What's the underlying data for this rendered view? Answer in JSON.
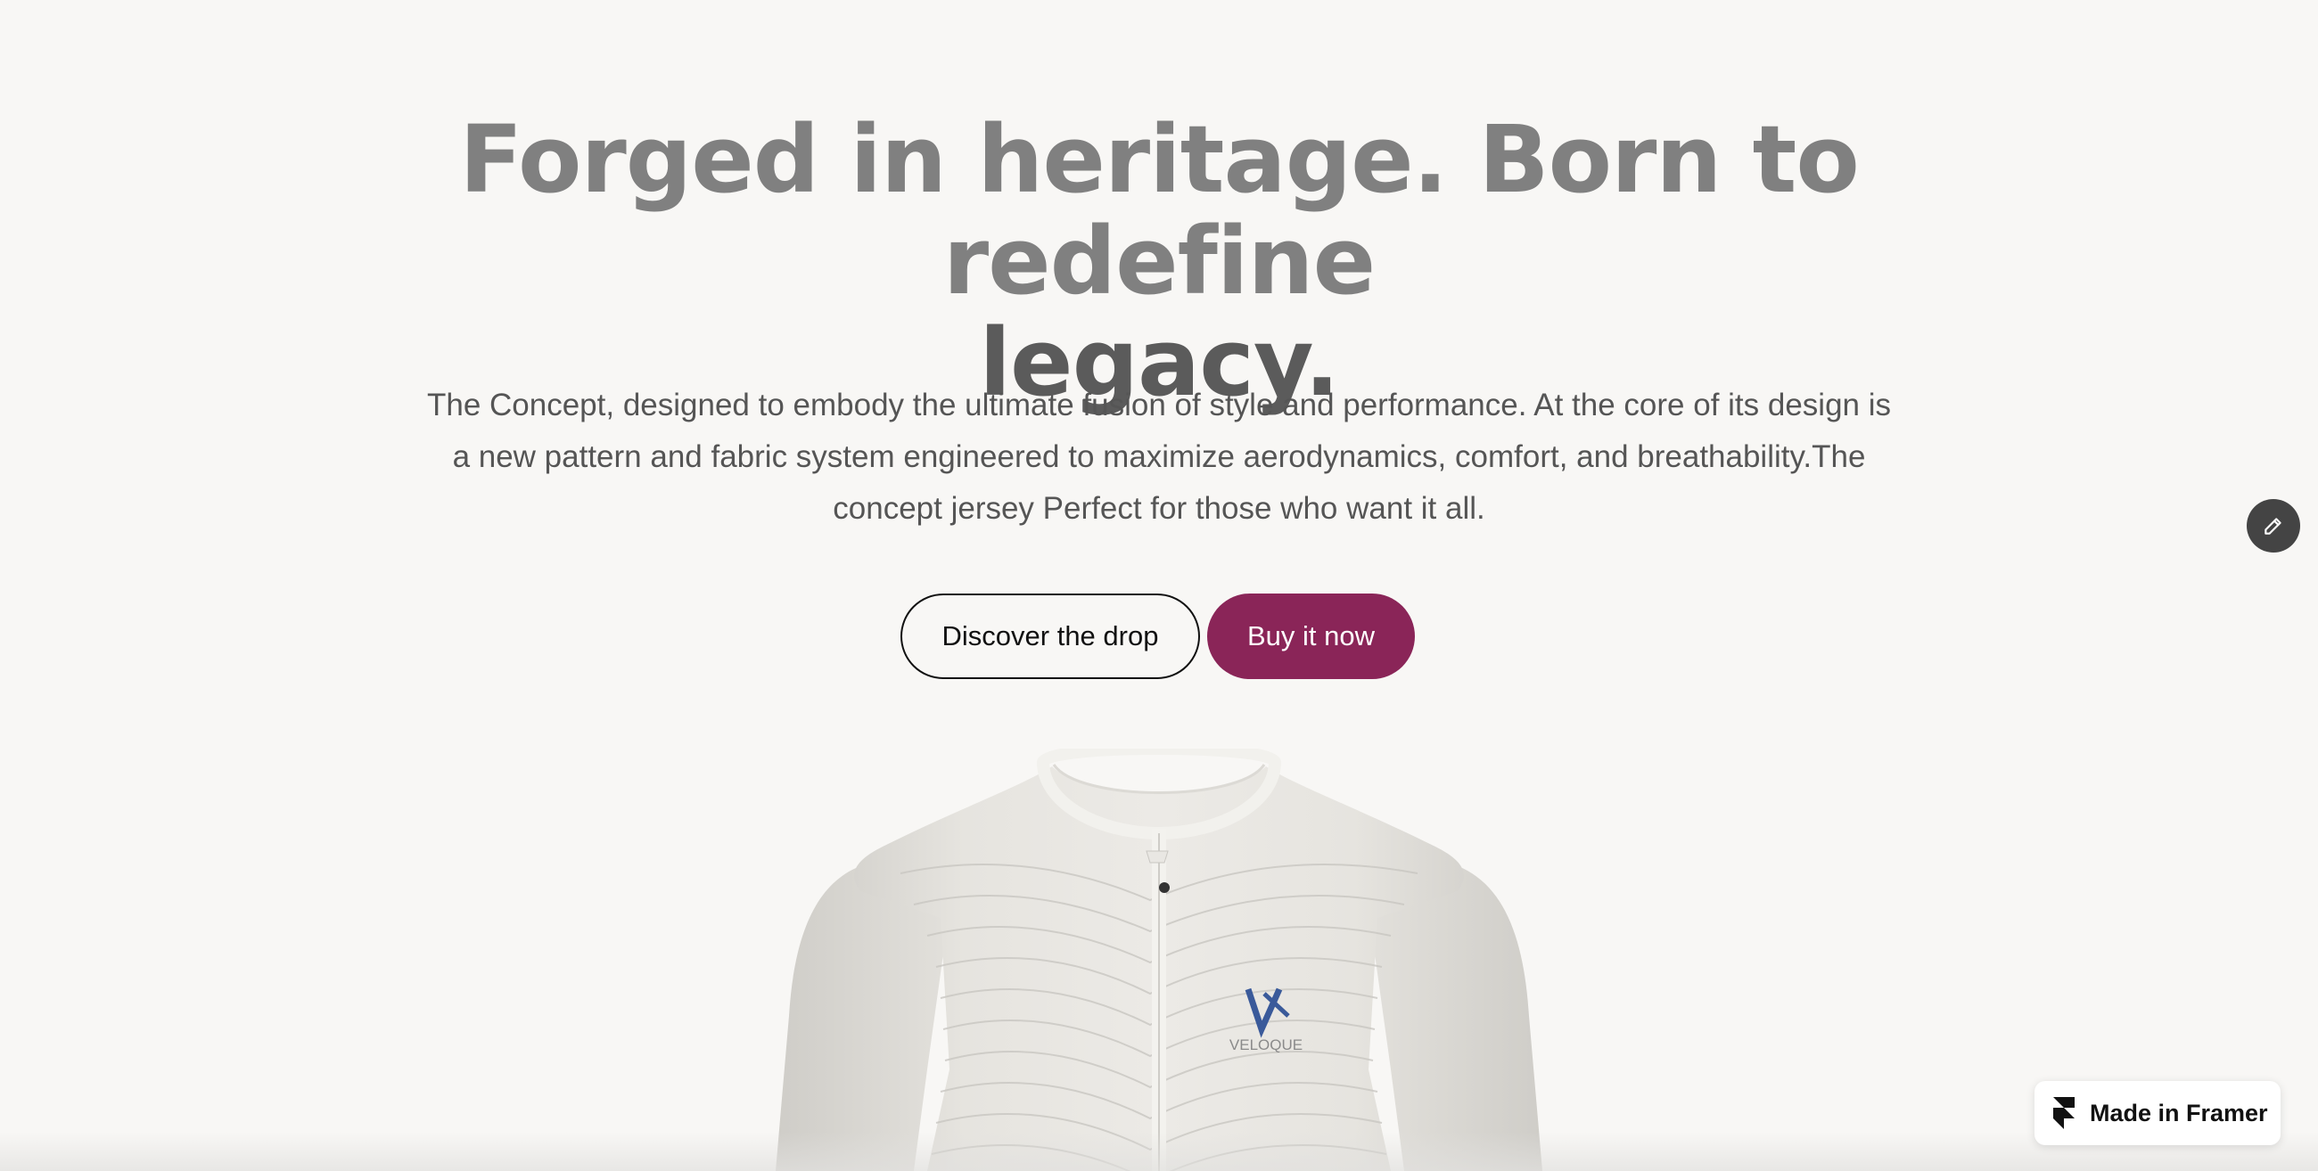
{
  "hero": {
    "headline_line1": "Forged in heritage. Born to redefine",
    "headline_line2": "legacy.",
    "description": "The Concept, designed to embody the ultimate fusion of style and performance. At the core of its design is a new pattern and fabric system engineered to maximize aerodynamics, comfort, and breathability.The concept jersey Perfect for those who want it all."
  },
  "buttons": {
    "discover_label": "Discover the drop",
    "buy_label": "Buy it now"
  },
  "product": {
    "brand_logo_text": "VELOQUE",
    "image_alt": "White cycling jersey"
  },
  "badge": {
    "label": "Made in Framer"
  },
  "icons": {
    "edit": "pencil-icon",
    "framer": "framer-logo-icon"
  },
  "colors": {
    "background": "#f8f7f5",
    "primary_button": "#8a2558",
    "logo_blue": "#3a5a9a"
  }
}
